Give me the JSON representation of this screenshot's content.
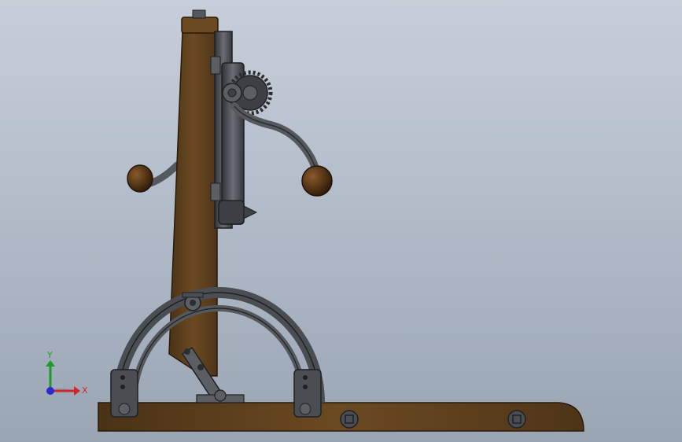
{
  "triad": {
    "x_label": "X",
    "y_label": "Y",
    "x_color": "#cc2a2a",
    "y_color": "#1f9a2a",
    "z_color": "#2a2ad0"
  },
  "colors": {
    "wood": "#5a3d1c",
    "wood_dark": "#3c2810",
    "metal": "#4a4d52",
    "metal_dark": "#2b2d31",
    "knob": "#4a2a10",
    "background_top": "#c7ced9",
    "background_bottom": "#9aa5b4"
  },
  "icons": {
    "triad": "xyz-reference-triad-icon"
  }
}
